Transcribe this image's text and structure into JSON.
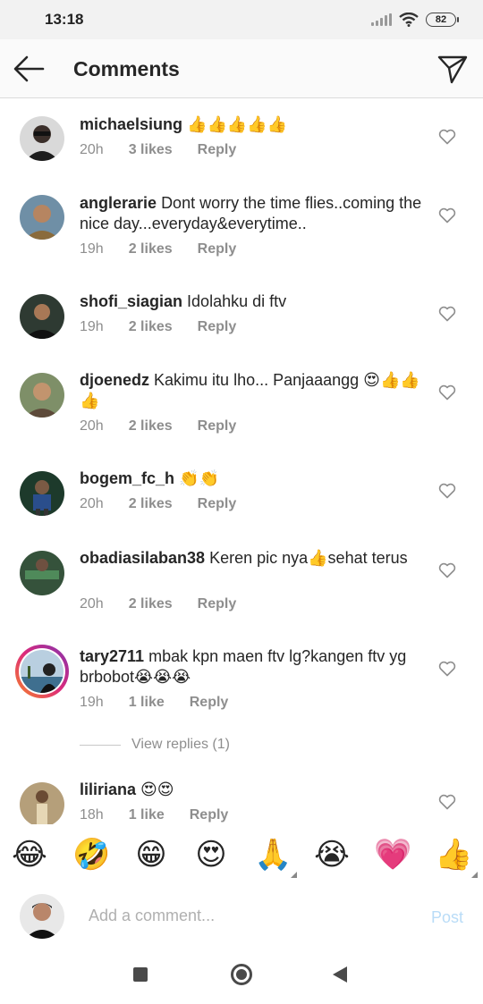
{
  "status": {
    "time": "13:18",
    "battery": "82"
  },
  "header": {
    "title": "Comments",
    "back_icon": "arrow-left-icon",
    "share_icon": "paper-plane-icon"
  },
  "comments": [
    {
      "user": "michaelsiung",
      "text": "👍👍👍👍👍",
      "time": "20h",
      "likes": "3 likes",
      "reply": "Reply"
    },
    {
      "user": "anglerarie",
      "text": "Dont worry the time flies..coming the nice day...everyday&everytime..",
      "time": "19h",
      "likes": "2 likes",
      "reply": "Reply"
    },
    {
      "user": "shofi_siagian",
      "text": "Idolahku di ftv",
      "time": "19h",
      "likes": "2 likes",
      "reply": "Reply"
    },
    {
      "user": "djoenedz",
      "text": "Kakimu itu lho... Panjaaangg 😍👍👍👍",
      "time": "20h",
      "likes": "2 likes",
      "reply": "Reply"
    },
    {
      "user": "bogem_fc_h",
      "text": "👏👏",
      "time": "20h",
      "likes": "2 likes",
      "reply": "Reply"
    },
    {
      "user": "obadiasilaban38",
      "text": "Keren pic nya👍sehat terus",
      "time": "20h",
      "likes": "2 likes",
      "reply": "Reply"
    },
    {
      "user": "tary2711",
      "text": "mbak kpn maen ftv lg?kangen ftv yg brbobot😭😭😭",
      "time": "19h",
      "likes": "1 like",
      "reply": "Reply"
    },
    {
      "user": "liliriana",
      "text": "😍😍",
      "time": "18h",
      "likes": "1 like",
      "reply": "Reply"
    }
  ],
  "view_replies": "View replies (1)",
  "emoji_bar": [
    "😂",
    "🤣",
    "😁",
    "😍",
    "🙏",
    "😭",
    "💗",
    "👍"
  ],
  "composer": {
    "placeholder": "Add a comment...",
    "post_label": "Post"
  },
  "colors": {
    "accent_blue_disabled": "#b9dcf7",
    "meta_gray": "#8e8e8e",
    "text": "#262626",
    "story_ring_start": "#f58529",
    "story_ring_end": "#dd2a7b"
  }
}
